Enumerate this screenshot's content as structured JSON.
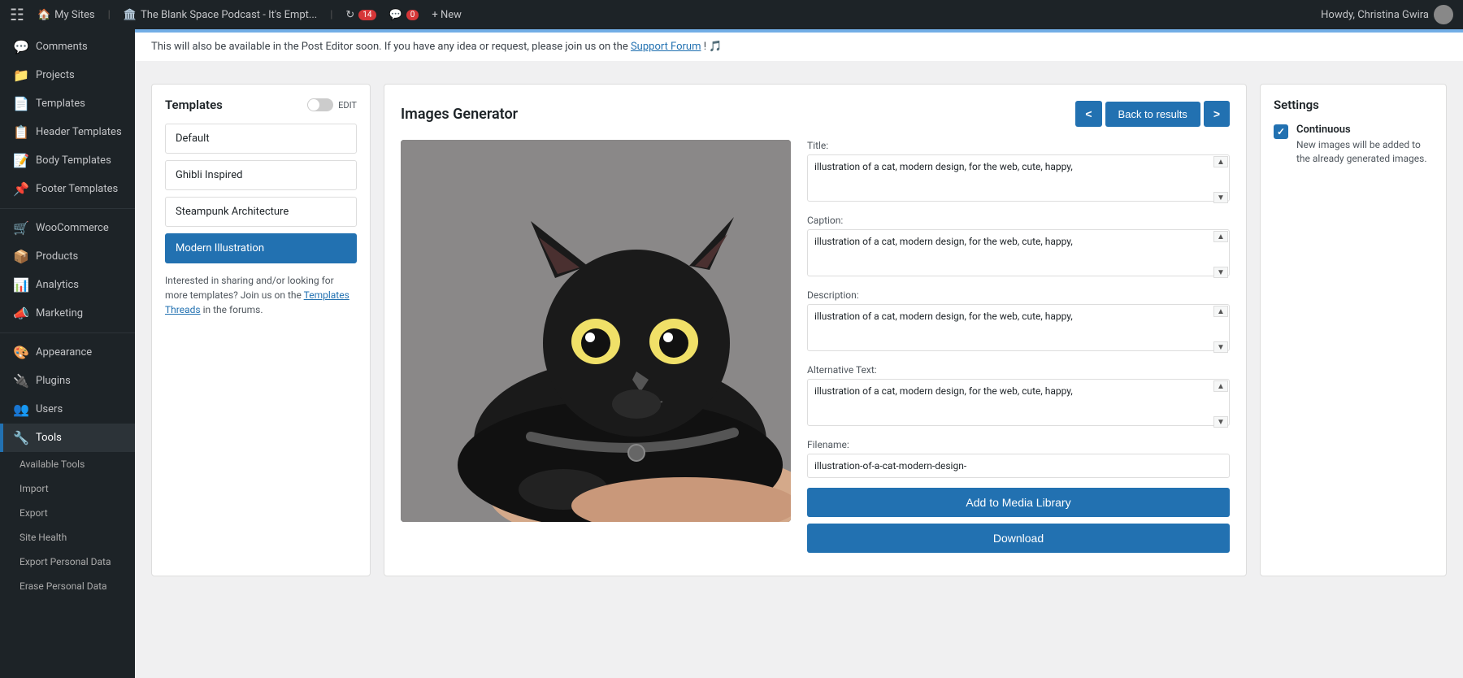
{
  "adminBar": {
    "wpLogo": "⊞",
    "mySites": "My Sites",
    "siteName": "The Blank Space Podcast - It's Empt...",
    "updateCount": "14",
    "commentCount": "0",
    "newLabel": "+ New",
    "howdy": "Howdy, Christina Gwira",
    "icons": {
      "refresh": "↻",
      "comment": "💬"
    }
  },
  "sidebar": {
    "items": [
      {
        "label": "Comments",
        "icon": "💬"
      },
      {
        "label": "Projects",
        "icon": "📁"
      },
      {
        "label": "Templates",
        "icon": "📄"
      },
      {
        "label": "Header Templates",
        "icon": "📋"
      },
      {
        "label": "Body Templates",
        "icon": "📝"
      },
      {
        "label": "Footer Templates",
        "icon": "📌"
      },
      {
        "label": "WooCommerce",
        "icon": "🛒"
      },
      {
        "label": "Products",
        "icon": "📦"
      },
      {
        "label": "Analytics",
        "icon": "📊"
      },
      {
        "label": "Marketing",
        "icon": "📣"
      },
      {
        "label": "Appearance",
        "icon": "🎨"
      },
      {
        "label": "Plugins",
        "icon": "🔌"
      },
      {
        "label": "Users",
        "icon": "👥"
      },
      {
        "label": "Tools",
        "icon": "🔧",
        "active": true
      }
    ],
    "subItems": [
      {
        "label": "Available Tools"
      },
      {
        "label": "Import"
      },
      {
        "label": "Export"
      },
      {
        "label": "Site Health"
      },
      {
        "label": "Export Personal Data"
      },
      {
        "label": "Erase Personal Data"
      }
    ]
  },
  "notice": {
    "text": "This will also be available in the Post Editor soon. If you have any idea or request, please join us on the ",
    "linkText": "Support Forum",
    "suffix": "! 🎵"
  },
  "templatesPanel": {
    "title": "Templates",
    "editLabel": "EDIT",
    "options": [
      {
        "label": "Default",
        "selected": false
      },
      {
        "label": "Ghibli Inspired",
        "selected": false
      },
      {
        "label": "Steampunk Architecture",
        "selected": false
      },
      {
        "label": "Modern Illustration",
        "selected": true
      }
    ],
    "promo": "Interested in sharing and/or looking for more templates? Join us on the ",
    "promoLink": "Templates Threads",
    "promoSuffix": " in the forums."
  },
  "generator": {
    "title": "Images Generator",
    "navPrev": "<",
    "navNext": ">",
    "backToResults": "Back to results",
    "fields": {
      "title": {
        "label": "Title:",
        "value": "illustration of a cat, modern design, for the web, cute, happy,"
      },
      "caption": {
        "label": "Caption:",
        "value": "illustration of a cat, modern design, for the web, cute, happy,"
      },
      "description": {
        "label": "Description:",
        "value": "illustration of a cat, modern design, for the web, cute, happy,"
      },
      "alternativeText": {
        "label": "Alternative Text:",
        "value": "illustration of a cat, modern design, for the web, cute, happy,"
      },
      "filename": {
        "label": "Filename:",
        "value": "illustration-of-a-cat-modern-design-"
      }
    },
    "addToLibraryBtn": "Add to Media Library",
    "downloadBtn": "Download"
  },
  "settings": {
    "title": "Settings",
    "continuous": {
      "label": "Continuous",
      "description": "New images will be added to the already generated images."
    }
  }
}
